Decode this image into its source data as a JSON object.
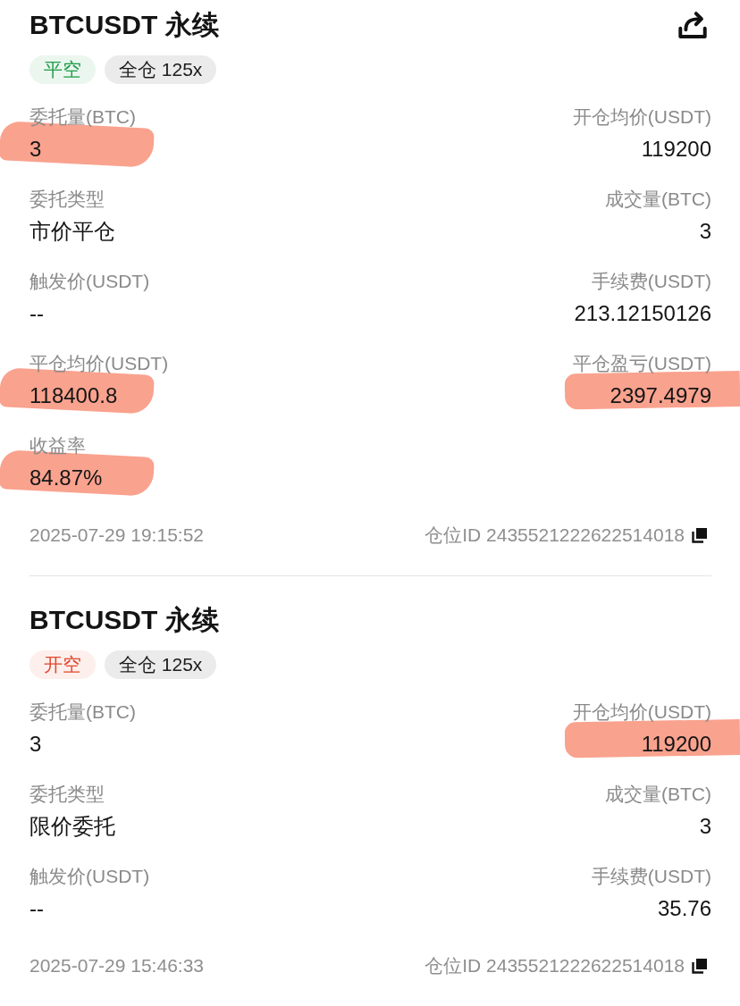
{
  "orders": [
    {
      "title": "BTCUSDT 永续",
      "share_icon": true,
      "tags": [
        {
          "label": "平空",
          "color": "#1f9e4a"
        },
        {
          "label": "全仓 125x",
          "color": "#1c1c1c"
        }
      ],
      "fields": [
        {
          "label": "委托量(BTC)",
          "value": "3",
          "highlighted": true
        },
        {
          "label": "开仓均价(USDT)",
          "value": "119200",
          "highlighted": false
        },
        {
          "label": "委托类型",
          "value": "市价平仓",
          "highlighted": false
        },
        {
          "label": "成交量(BTC)",
          "value": "3",
          "highlighted": false
        },
        {
          "label": "触发价(USDT)",
          "value": "--",
          "highlighted": false
        },
        {
          "label": "手续费(USDT)",
          "value": "213.12150126",
          "highlighted": false
        },
        {
          "label": "平仓均价(USDT)",
          "value": "118400.8",
          "highlighted": true
        },
        {
          "label": "平仓盈亏(USDT)",
          "value": "2397.4979",
          "highlighted": true
        },
        {
          "label": "收益率",
          "value": "84.87%",
          "highlighted": true
        }
      ],
      "time": "2025-07-29 19:15:52",
      "position_id": "仓位ID 2435521222622514018"
    },
    {
      "title": "BTCUSDT 永续",
      "share_icon": false,
      "tags": [
        {
          "label": "开空",
          "color": "#e04a2f"
        },
        {
          "label": "全仓 125x",
          "color": "#1c1c1c"
        }
      ],
      "fields": [
        {
          "label": "委托量(BTC)",
          "value": "3",
          "highlighted": false
        },
        {
          "label": "开仓均价(USDT)",
          "value": "119200",
          "highlighted": true
        },
        {
          "label": "委托类型",
          "value": "限价委托",
          "highlighted": false
        },
        {
          "label": "成交量(BTC)",
          "value": "3",
          "highlighted": false
        },
        {
          "label": "触发价(USDT)",
          "value": "--",
          "highlighted": false
        },
        {
          "label": "手续费(USDT)",
          "value": "35.76",
          "highlighted": false
        }
      ],
      "time": "2025-07-29 15:46:33",
      "position_id": "仓位ID 2435521222622514018"
    }
  ]
}
